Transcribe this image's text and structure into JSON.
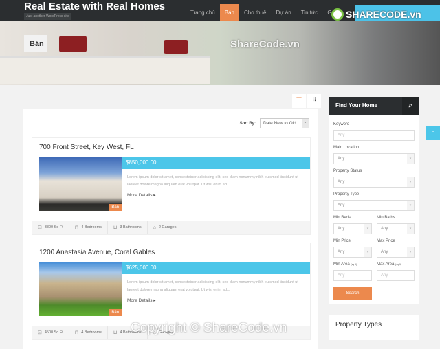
{
  "header": {
    "site_title": "Real Estate with Real Homes",
    "tagline": "Just another WordPress site",
    "nav": [
      {
        "label": "Trang chủ"
      },
      {
        "label": "Bán",
        "active": true
      },
      {
        "label": "Cho thuê"
      },
      {
        "label": "Dự án"
      },
      {
        "label": "Tin tức"
      },
      {
        "label": "G"
      }
    ],
    "logo": "SHARECODE.vn"
  },
  "hero": {
    "title": "Bán",
    "watermark": "ShareCode.vn"
  },
  "listing": {
    "sort_label": "Sort By:",
    "sort_value": "Date New to Old",
    "view_modes": [
      "list-icon",
      "grid-icon"
    ],
    "properties": [
      {
        "title": "700 Front Street, Key West, FL",
        "price": "$850,000.00",
        "status": "Bán",
        "description": "Lorem ipsum dolor sit amet, consectetuer adipiscing elit, sed diam nonummy nibh euismod tincidunt ut laoreet dolore magna aliquam erat volutpat. Ut wisi enim ad...",
        "more": "More Details",
        "features": [
          "3800 Sq Ft",
          "4 Bedrooms",
          "3 Bathrooms",
          "2 Garages"
        ]
      },
      {
        "title": "1200 Anastasia Avenue, Coral Gables",
        "price": "$625,000.00",
        "status": "Bán",
        "description": "Lorem ipsum dolor sit amet, consectetuer adipiscing elit, sed diam nonummy nibh euismod tincidunt ut laoreet dolore magna aliquam erat volutpat. Ut wisi enim ad...",
        "more": "More Details",
        "features": [
          "4500 Sq Ft",
          "4 Bedrooms",
          "4 Bathrooms",
          "Garages"
        ]
      }
    ]
  },
  "sidebar": {
    "title": "Find Your Home",
    "keyword": {
      "label": "Keyword",
      "placeholder": "Any"
    },
    "main_location": {
      "label": "Main Location",
      "value": "Any"
    },
    "property_status": {
      "label": "Property Status",
      "value": "Any"
    },
    "property_type": {
      "label": "Property Type",
      "value": "Any"
    },
    "min_beds": {
      "label": "Min Beds",
      "value": "Any"
    },
    "min_baths": {
      "label": "Min Baths",
      "value": "Any"
    },
    "min_price": {
      "label": "Min Price",
      "value": "Any"
    },
    "max_price": {
      "label": "Max Price",
      "value": "Any"
    },
    "min_area": {
      "label": "Min Area",
      "unit": "(sq ft)",
      "placeholder": "Any"
    },
    "max_area": {
      "label": "Max Area",
      "unit": "(sq ft)",
      "placeholder": "Any"
    },
    "search": "Search",
    "property_types_title": "Property Types"
  },
  "watermark": "Copyright © ShareCode.vn",
  "colors": {
    "accent": "#ec894d",
    "blue": "#4cc6e9",
    "dark": "#2b2e30"
  }
}
